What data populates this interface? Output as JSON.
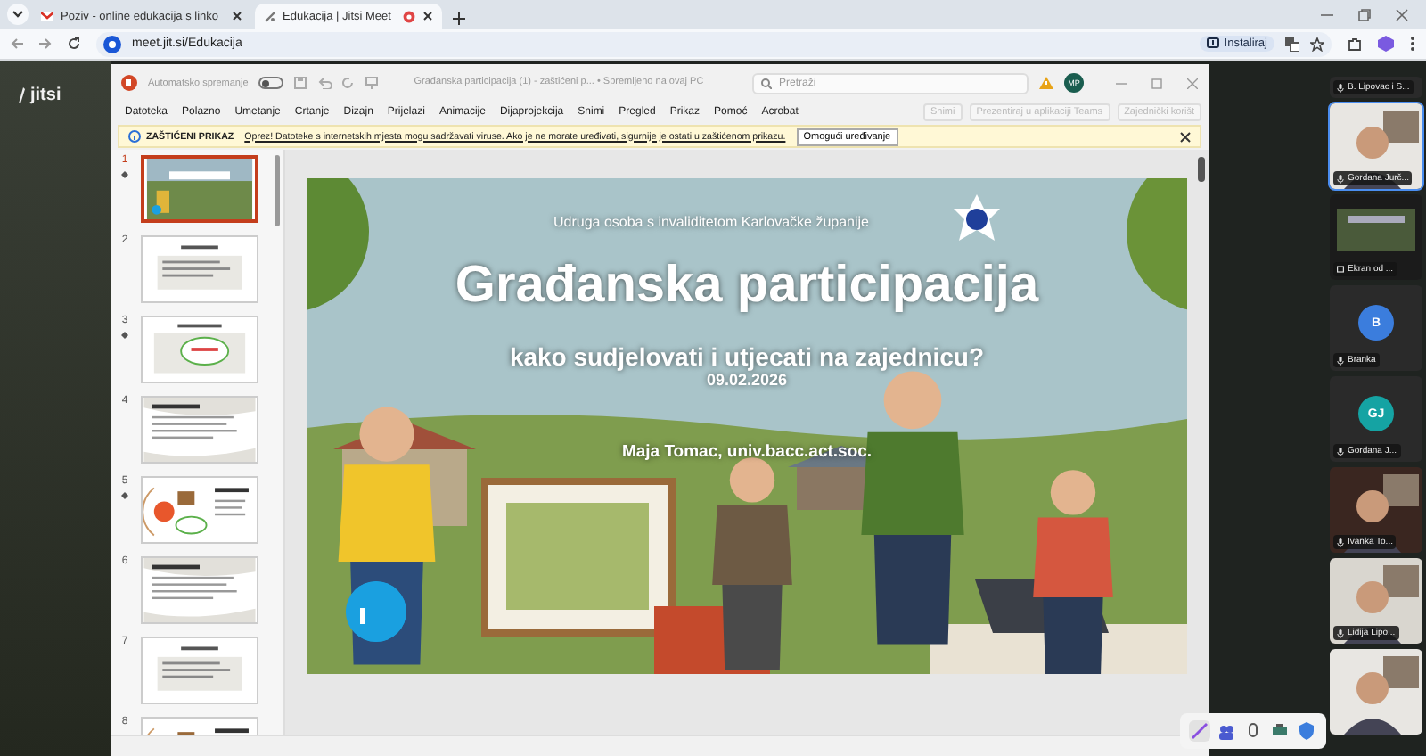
{
  "browser": {
    "tabs": [
      {
        "title": "Poziv - online edukacija s linko",
        "selected": false,
        "recording": false
      },
      {
        "title": "Edukacija | Jitsi Meet",
        "selected": true,
        "recording": true
      }
    ],
    "address": "meet.jit.si/Edukacija",
    "install_label": "Instaliraj"
  },
  "jitsi": {
    "logo": "jitsi"
  },
  "powerpoint": {
    "autosave_label": "Automatsko spremanje",
    "autosave_on": false,
    "title": "Građanska participacija (1) - zaštićeni p... • Spremljeno na ovaj PC",
    "search_placeholder": "Pretraži",
    "account_initials": "MP",
    "menu": [
      "Datoteka",
      "Polazno",
      "Umetanje",
      "Crtanje",
      "Dizajn",
      "Prijelazi",
      "Animacije",
      "Dijaprojekcija",
      "Snimi",
      "Pregled",
      "Prikaz",
      "Pomoć",
      "Acrobat"
    ],
    "ribbon_buttons": [
      "Snimi",
      "Prezentiraj u aplikaciji Teams",
      "Zajednički korišt"
    ],
    "protected_view": {
      "label": "ZAŠTIĆENI PRIKAZ",
      "message": "Oprez! Datoteke s internetskih mjesta mogu sadržavati viruse. Ako je ne morate uređivati, sigurnije je ostati u zaštićenom prikazu.",
      "button": "Omogući uređivanje"
    },
    "slides": [
      {
        "number": "1",
        "selected": true,
        "animated": true,
        "kind": "picture"
      },
      {
        "number": "2",
        "selected": false,
        "animated": false,
        "kind": "list"
      },
      {
        "number": "3",
        "selected": false,
        "animated": true,
        "kind": "cloud"
      },
      {
        "number": "4",
        "selected": false,
        "animated": false,
        "kind": "text"
      },
      {
        "number": "5",
        "selected": false,
        "animated": true,
        "kind": "diagram"
      },
      {
        "number": "6",
        "selected": false,
        "animated": false,
        "kind": "text"
      },
      {
        "number": "7",
        "selected": false,
        "animated": false,
        "kind": "list"
      },
      {
        "number": "8",
        "selected": false,
        "animated": false,
        "kind": "diagram"
      }
    ],
    "current_slide": {
      "organization": "Udruga osoba s invaliditetom Karlovačke županije",
      "title": "Građanska participacija",
      "subtitle": "kako sudjelovati i utjecati na zajednicu?",
      "date": "09.02.2026",
      "author": "Maja Tomac, univ.bacc.act.soc."
    }
  },
  "participants": [
    {
      "name": "B. Lipovac i S...",
      "kind": "video",
      "selected": false
    },
    {
      "name": "Gordana Jurč...",
      "kind": "video",
      "selected": true
    },
    {
      "name": "Ekran od ...",
      "kind": "screen",
      "selected": false
    },
    {
      "name": "Branka",
      "kind": "avatar",
      "initials": "B",
      "color": "#3b7ddd",
      "selected": false
    },
    {
      "name": "Gordana J...",
      "kind": "avatar",
      "initials": "GJ",
      "color": "#15a3a3",
      "selected": false
    },
    {
      "name": "Ivanka To...",
      "kind": "video",
      "selected": false
    },
    {
      "name": "Lidija Lipo...",
      "kind": "video",
      "selected": false
    },
    {
      "kind": "video",
      "selected": false
    }
  ]
}
